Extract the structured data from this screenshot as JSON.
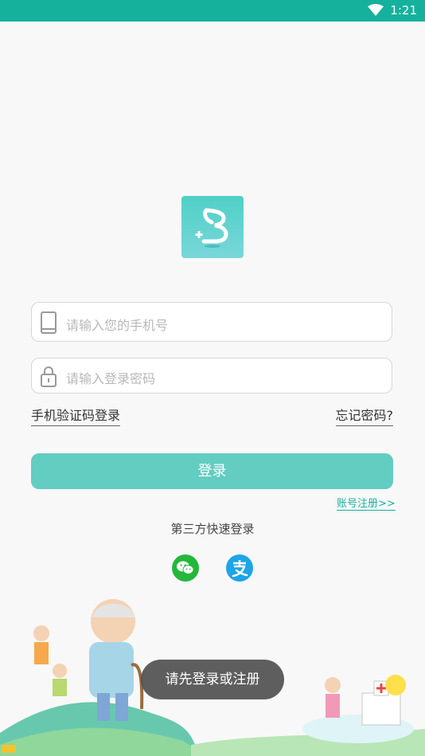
{
  "status": {
    "time": "1:21",
    "wifi_icon": "wifi-icon"
  },
  "logo": {
    "name": "app-logo"
  },
  "form": {
    "phone_placeholder": "请输入您的手机号",
    "password_placeholder": "请输入登录密码",
    "sms_login_label": "手机验证码登录",
    "forgot_password_label": "忘记密码?",
    "login_button": "登录",
    "register_link": "账号注册>>"
  },
  "third_party": {
    "title": "第三方快速登录",
    "wechat_icon": "wechat-icon",
    "alipay_icon": "alipay-icon"
  },
  "toast": {
    "message": "请先登录或注册"
  },
  "colors": {
    "primary": "#16b19c",
    "button": "#63cdc1",
    "wechat": "#22b83a",
    "alipay": "#1ea4e7"
  }
}
